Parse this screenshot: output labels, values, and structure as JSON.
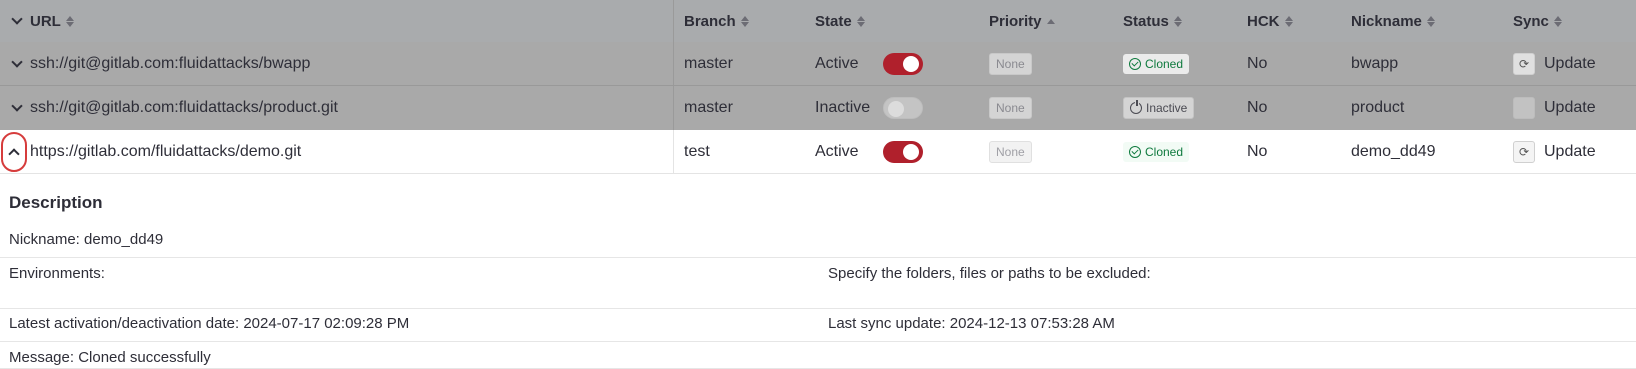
{
  "headers": {
    "url": "URL",
    "branch": "Branch",
    "state": "State",
    "priority": "Priority",
    "status": "Status",
    "hck": "HCK",
    "nickname": "Nickname",
    "sync": "Sync"
  },
  "rows": [
    {
      "url": "ssh://git@gitlab.com:fluidattacks/bwapp",
      "branch": "master",
      "state": "Active",
      "state_on": true,
      "priority": "None",
      "status": "Cloned",
      "hck": "No",
      "nickname": "bwapp",
      "sync_label": "Update",
      "expanded": false
    },
    {
      "url": "ssh://git@gitlab.com:fluidattacks/product.git",
      "branch": "master",
      "state": "Inactive",
      "state_on": false,
      "priority": "None",
      "status": "Inactive",
      "hck": "No",
      "nickname": "product",
      "sync_label": "Update",
      "expanded": false
    },
    {
      "url": "https://gitlab.com/fluidattacks/demo.git",
      "branch": "test",
      "state": "Active",
      "state_on": true,
      "priority": "None",
      "status": "Cloned",
      "hck": "No",
      "nickname": "demo_dd49",
      "sync_label": "Update",
      "expanded": true
    }
  ],
  "details": {
    "title": "Description",
    "nickname": "Nickname: demo_dd49",
    "environments": "Environments:",
    "excluded": "Specify the folders, files or paths to be excluded:",
    "latest_activation": "Latest activation/deactivation date: 2024-07-17 02:09:28 PM",
    "last_sync": "Last sync update: 2024-12-13 07:53:28 AM",
    "message": "Message: Cloned successfully"
  },
  "colors": {
    "toggle_on": "#b0202c",
    "cloned": "#0f7a3e",
    "header_bg": "#a9abad",
    "expand_highlight": "#d63c3c"
  },
  "icons": {
    "expand_collapsed": "chevron-down-icon",
    "expand_open": "chevron-up-icon",
    "cloned": "check-circle-icon",
    "inactive": "power-icon",
    "sync": "refresh-icon"
  }
}
